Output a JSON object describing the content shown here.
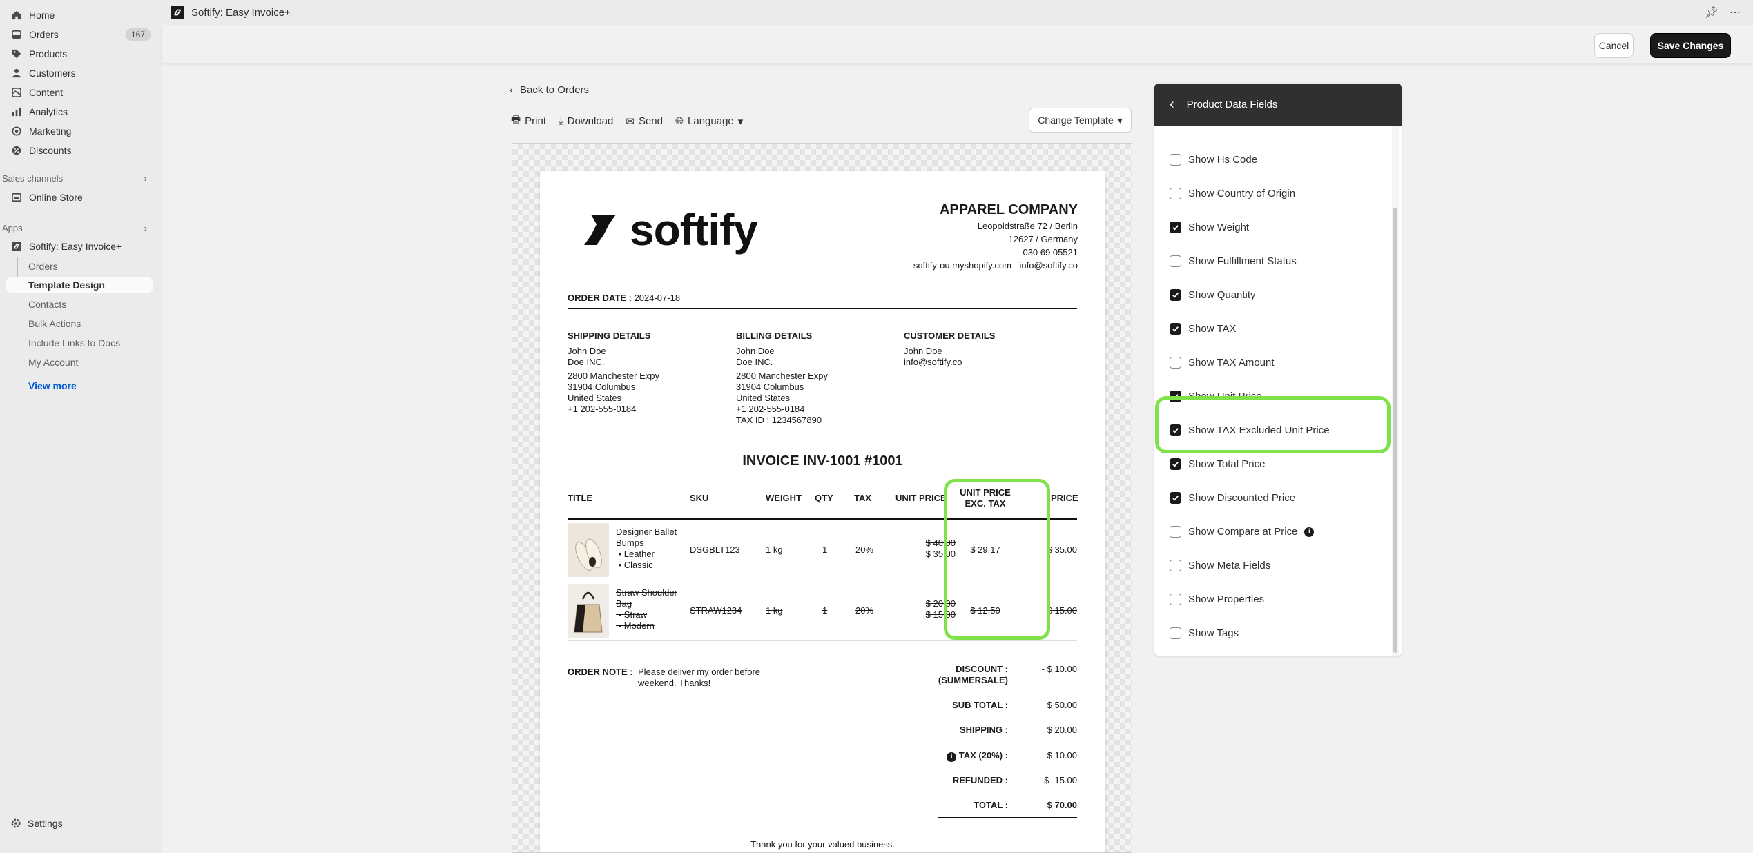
{
  "sidebar": {
    "nav": [
      {
        "label": "Home",
        "icon": "home-icon"
      },
      {
        "label": "Orders",
        "icon": "orders-icon",
        "badge": "167"
      },
      {
        "label": "Products",
        "icon": "tag-icon"
      },
      {
        "label": "Customers",
        "icon": "person-icon"
      },
      {
        "label": "Content",
        "icon": "content-icon"
      },
      {
        "label": "Analytics",
        "icon": "chart-icon"
      },
      {
        "label": "Marketing",
        "icon": "target-icon"
      },
      {
        "label": "Discounts",
        "icon": "discount-icon"
      }
    ],
    "sales_channels_label": "Sales channels",
    "online_store": "Online Store",
    "apps_label": "Apps",
    "app_name": "Softify: Easy Invoice+",
    "app_sub": [
      "Orders",
      "Template Design",
      "Contacts",
      "Bulk Actions",
      "Include Links to Docs",
      "My Account"
    ],
    "view_more": "View more",
    "settings": "Settings"
  },
  "appbar": {
    "title": "Softify: Easy Invoice+"
  },
  "actions": {
    "cancel": "Cancel",
    "save": "Save Changes"
  },
  "editor": {
    "back": "Back to Orders",
    "toolbar": {
      "print": "Print",
      "download": "Download",
      "send": "Send",
      "language": "Language"
    },
    "change_template": "Change Template"
  },
  "invoice": {
    "brand": "softify",
    "company": {
      "name": "APPAREL COMPANY",
      "address1": "Leopoldstraße 72 / Berlin",
      "address2": "12627 / Germany",
      "phone": "030 69 05521",
      "web": "softify-ou.myshopify.com - info@softify.co"
    },
    "order_date_label": "ORDER DATE :",
    "order_date": "2024-07-18",
    "shipping": {
      "title": "SHIPPING DETAILS",
      "name": "John Doe",
      "company": "Doe INC.",
      "street": "2800 Manchester Expy",
      "city": "31904 Columbus",
      "country": "United States",
      "phone": "+1 202-555-0184"
    },
    "billing": {
      "title": "BILLING DETAILS",
      "name": "John Doe",
      "company": "Doe INC.",
      "street": "2800 Manchester Expy",
      "city": "31904 Columbus",
      "country": "United States",
      "phone": "+1 202-555-0184",
      "tax_id": "TAX ID :  1234567890"
    },
    "customer": {
      "title": "CUSTOMER DETAILS",
      "name": "John Doe",
      "email": "info@softify.co"
    },
    "title": "INVOICE  INV-1001    #1001",
    "columns": {
      "title": "TITLE",
      "sku": "SKU",
      "weight": "WEIGHT",
      "qty": "QTY",
      "tax": "TAX",
      "unit_price": "UNIT PRICE",
      "unit_excl_1": "UNIT PRICE",
      "unit_excl_2": "EXC. TAX",
      "price": "PRICE"
    },
    "items": [
      {
        "title1": "Designer Ballet",
        "title2": "Bumps",
        "opt1": "Leather",
        "opt2": "Classic",
        "sku": "DSGBLT123",
        "weight": "1 kg",
        "qty": "1",
        "tax": "20%",
        "unit_old": "$ 40.00",
        "unit_new": "$ 35.00",
        "unit_excl": "$ 29.17",
        "price": "$ 35.00"
      },
      {
        "title1": "Straw Shoulder",
        "title2": "Bag",
        "opt1": "Straw",
        "opt2": "Modern",
        "sku": "STRAW1234",
        "weight": "1 kg",
        "qty": "1",
        "tax": "20%",
        "unit_old": "$ 20.00",
        "unit_new": "$ 15.00",
        "unit_excl": "$ 12.50",
        "price": "$ 15.00"
      }
    ],
    "note_label": "ORDER NOTE :",
    "note1": "Please deliver my order before",
    "note2": "weekend. Thanks!",
    "totals": {
      "discount_label": "DISCOUNT :",
      "discount_sub": "(SUMMERSALE)",
      "discount": "- $ 10.00",
      "subtotal_label": "SUB TOTAL :",
      "subtotal": "$ 50.00",
      "shipping_label": "SHIPPING :",
      "shipping": "$ 20.00",
      "tax_label": "TAX (20%) :",
      "tax": "$ 10.00",
      "refunded_label": "REFUNDED :",
      "refunded": "$ -15.00",
      "total_label": "TOTAL :",
      "total": "$ 70.00"
    },
    "thanks": "Thank you for your valued business."
  },
  "panel": {
    "title": "Product Data Fields",
    "options": [
      {
        "label": "Show Hs Code",
        "checked": false
      },
      {
        "label": "Show Country of Origin",
        "checked": false
      },
      {
        "label": "Show Weight",
        "checked": true
      },
      {
        "label": "Show Fulfillment Status",
        "checked": false
      },
      {
        "label": "Show Quantity",
        "checked": true
      },
      {
        "label": "Show TAX",
        "checked": true
      },
      {
        "label": "Show TAX Amount",
        "checked": false
      },
      {
        "label": "Show Unit Price",
        "checked": true
      },
      {
        "label": "Show TAX Excluded Unit Price",
        "checked": true
      },
      {
        "label": "Show Total Price",
        "checked": true
      },
      {
        "label": "Show Discounted Price",
        "checked": true
      },
      {
        "label": "Show Compare at Price",
        "checked": false,
        "info": true
      },
      {
        "label": "Show Meta Fields",
        "checked": false
      },
      {
        "label": "Show Properties",
        "checked": false
      },
      {
        "label": "Show Tags",
        "checked": false
      }
    ]
  },
  "colors": {
    "highlight": "#7fe24b",
    "primary": "#1a1a1a",
    "link": "#005bd3"
  }
}
